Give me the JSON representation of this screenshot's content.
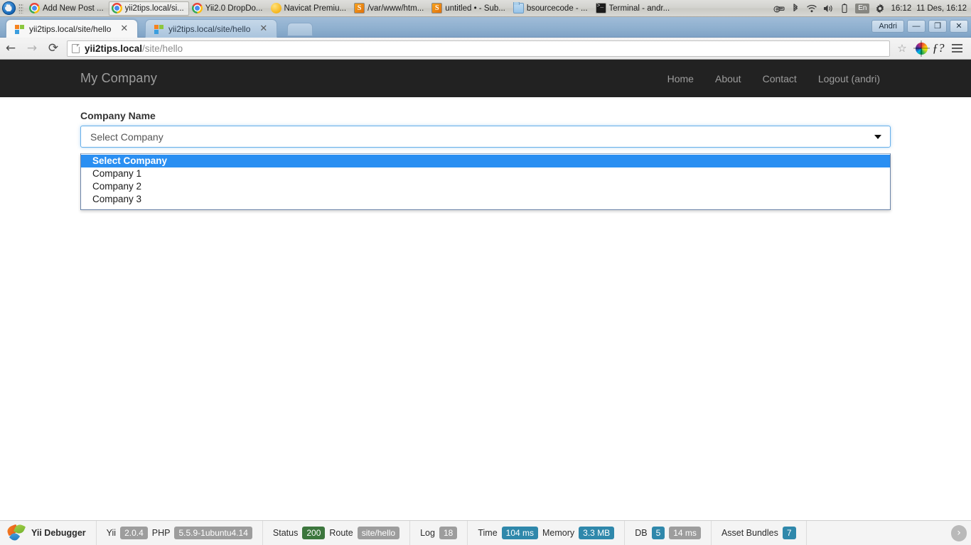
{
  "taskbar": {
    "items": [
      {
        "label": "Add New Post ...",
        "icon": "chrome-icon",
        "active": false
      },
      {
        "label": "yii2tips.local/si...",
        "icon": "chrome-icon",
        "active": true
      },
      {
        "label": "Yii2.0 DropDo...",
        "icon": "chrome-icon",
        "active": false
      },
      {
        "label": "Navicat Premiu...",
        "icon": "navicat-icon",
        "active": false
      },
      {
        "label": "/var/www/htm...",
        "icon": "sublime-icon",
        "active": false
      },
      {
        "label": "untitled • - Sub...",
        "icon": "sublime-icon",
        "active": false
      },
      {
        "label": "bsourcecode - ...",
        "icon": "folder-icon",
        "active": false
      },
      {
        "label": "Terminal - andr...",
        "icon": "terminal-icon",
        "active": false
      }
    ],
    "tray": {
      "keyboard_layout": "En",
      "clock": "16:12",
      "date_clock": "11 Des, 16:12",
      "icons": [
        "network-icon",
        "bluetooth-icon",
        "wifi-icon",
        "volume-icon",
        "battery-icon",
        "gear-icon"
      ]
    }
  },
  "browser": {
    "tabs": [
      {
        "title": "yii2tips.local/site/hello",
        "active": true
      },
      {
        "title": "yii2tips.local/site/hello",
        "active": false
      }
    ],
    "window": {
      "user": "Andri",
      "minimize": "—",
      "maximize": "❐",
      "close": "✕"
    },
    "toolbar": {
      "back": "←",
      "forward": "→",
      "reload": "⟳",
      "star": "☆",
      "extension_f": "ƒ?",
      "url_host": "yii2tips.local",
      "url_path": "/site/hello"
    }
  },
  "site": {
    "brand": "My Company",
    "nav": [
      {
        "label": "Home"
      },
      {
        "label": "About"
      },
      {
        "label": "Contact"
      },
      {
        "label": "Logout (andri)"
      }
    ],
    "form": {
      "label": "Company Name",
      "select_value": "Select Company",
      "options": [
        {
          "label": "Select Company",
          "selected": true
        },
        {
          "label": "Company 1",
          "selected": false
        },
        {
          "label": "Company 2",
          "selected": false
        },
        {
          "label": "Company 3",
          "selected": false
        }
      ]
    }
  },
  "debugbar": {
    "title": "Yii Debugger",
    "yii_label": "Yii",
    "yii_version": "2.0.4",
    "php_label": "PHP",
    "php_version": "5.5.9-1ubuntu4.14",
    "status_label": "Status",
    "status_code": "200",
    "route_label": "Route",
    "route_value": "site/hello",
    "log_label": "Log",
    "log_count": "18",
    "time_label": "Time",
    "time_value": "104 ms",
    "memory_label": "Memory",
    "memory_value": "3.3 MB",
    "db_label": "DB",
    "db_count": "5",
    "db_time": "14 ms",
    "asset_label": "Asset Bundles",
    "asset_count": "7",
    "toggle": "›"
  },
  "colors": {
    "navbar_bg": "#222222",
    "accent_blue": "#2a8ff2",
    "focus_blue": "#66afe9",
    "badge_blue": "#2f88ab",
    "badge_green": "#3c763d",
    "badge_gray": "#9d9d9d"
  }
}
